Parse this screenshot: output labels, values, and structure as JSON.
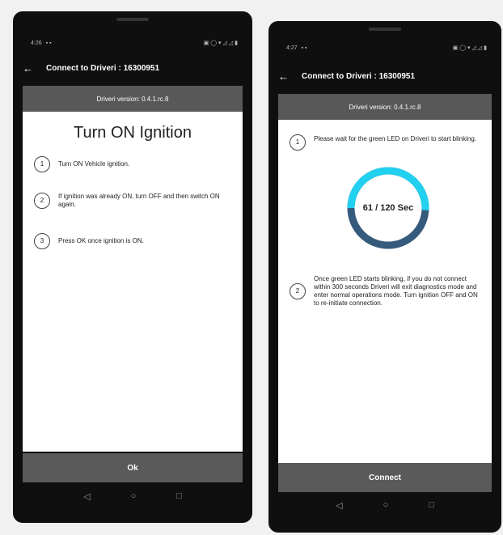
{
  "left_screen": {
    "status_time": "4:26",
    "app_title": "Connect to Driveri : 16300951",
    "version": "Driveri version: 0.4.1.rc.8",
    "heading": "Turn ON Ignition",
    "steps": [
      {
        "num": "1",
        "text": "Turn ON Vehicle ignition."
      },
      {
        "num": "2",
        "text": "If ignition was already ON, turn OFF and then switch ON again."
      },
      {
        "num": "3",
        "text": "Press OK once ignition is ON."
      }
    ],
    "action_label": "Ok"
  },
  "right_screen": {
    "status_time": "4:27",
    "app_title": "Connect to Driveri : 16300951",
    "version": "Driveri version: 0.4.1.rc.8",
    "steps": [
      {
        "num": "1",
        "text": "Please wait for the green LED on Driveri to start blinking."
      },
      {
        "num": "2",
        "text": "Once green LED starts blinking, if you do not connect within 300 seconds Driveri will exit diagnostics mode and enter normal operations mode. Turn ignition OFF and ON to re-initiate connection."
      }
    ],
    "timer": {
      "elapsed": 61,
      "total": 120,
      "label": "61 / 120 Sec",
      "progress_color": "#22d0f0",
      "track_color": "#355a7c"
    },
    "action_label": "Connect"
  },
  "icons": {
    "back": "arrow-left-icon",
    "nav": [
      "back-triangle-icon",
      "home-circle-icon",
      "recents-square-icon"
    ]
  },
  "colors": {
    "bar_gray": "#5a5a5a",
    "phone_black": "#0f0f0f"
  }
}
